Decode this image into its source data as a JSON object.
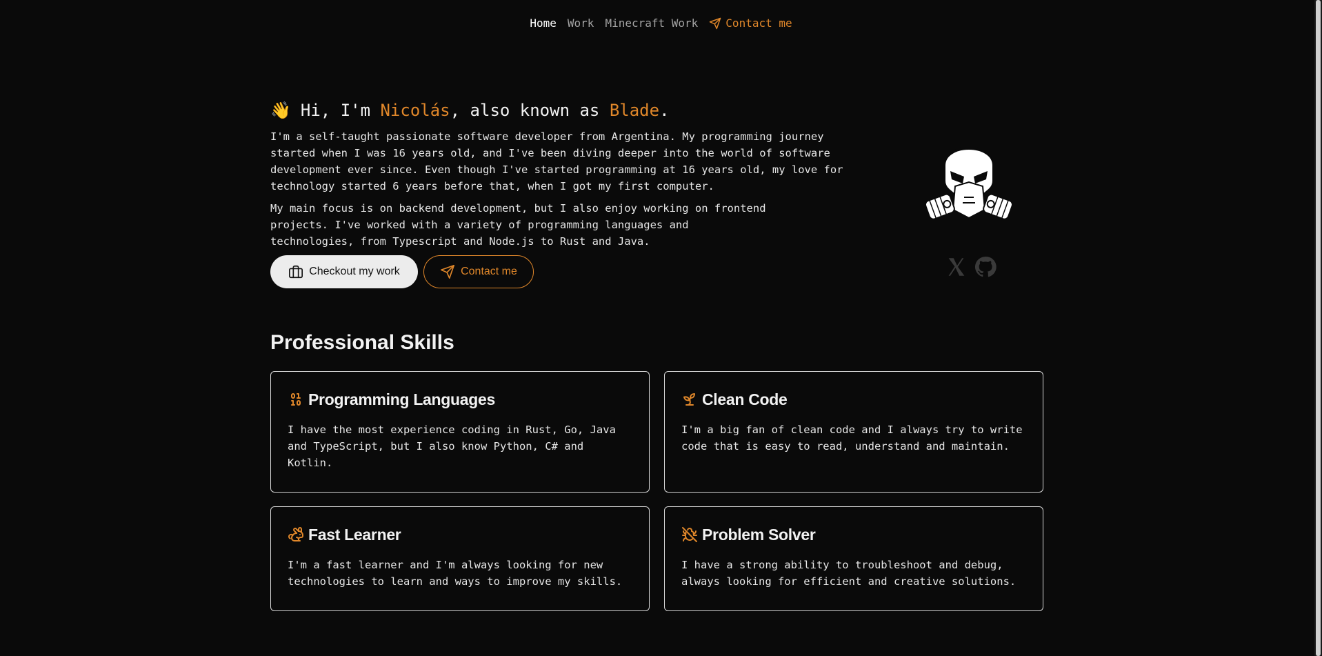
{
  "nav": {
    "items": [
      {
        "label": "Home"
      },
      {
        "label": "Work"
      },
      {
        "label": "Minecraft Work"
      },
      {
        "label": "Contact me"
      }
    ]
  },
  "hero": {
    "wave": "👋",
    "greeting": "Hi, I'm ",
    "name": "Nicolás",
    "aka": ", also known as ",
    "alias": "Blade",
    "period": ".",
    "paragraph1": "I'm a self-taught passionate software developer from Argentina. My programming journey started when I was 16 years old, and I've been diving deeper into the world of software development ever since. Even though I've started programming at 16 years old, my love for technology started 6 years before that, when I got my first computer.",
    "paragraph2": "My main focus is on backend development, but I also enjoy working on frontend projects. I've worked with a variety of programming languages and technologies, from Typescript and Node.js to Rust and Java.",
    "primary_button": "Checkout my work",
    "secondary_button": "Contact me"
  },
  "socials": [
    {
      "icon": "x-icon"
    },
    {
      "icon": "github-icon"
    }
  ],
  "skills": {
    "title": "Professional Skills",
    "cards": [
      {
        "icon": "binary-icon",
        "title": "Programming Languages",
        "body": "I have the most experience coding in Rust, Go, Java and TypeScript, but I also know Python, C# and Kotlin."
      },
      {
        "icon": "sprout-icon",
        "title": "Clean Code",
        "body": "I'm a big fan of clean code and I always try to write code that is easy to read, understand and maintain."
      },
      {
        "icon": "rabbit-icon",
        "title": "Fast Learner",
        "body": "I'm a fast learner and I'm always looking for new technologies to learn and ways to improve my skills."
      },
      {
        "icon": "bug-off-icon",
        "title": "Problem Solver",
        "body": "I have a strong ability to troubleshoot and debug, always looking for efficient and creative solutions."
      }
    ]
  },
  "colors": {
    "background": "#0a0a0a",
    "accent": "#e0872a",
    "text": "#e8e8e8",
    "muted": "#a3a3a3"
  }
}
